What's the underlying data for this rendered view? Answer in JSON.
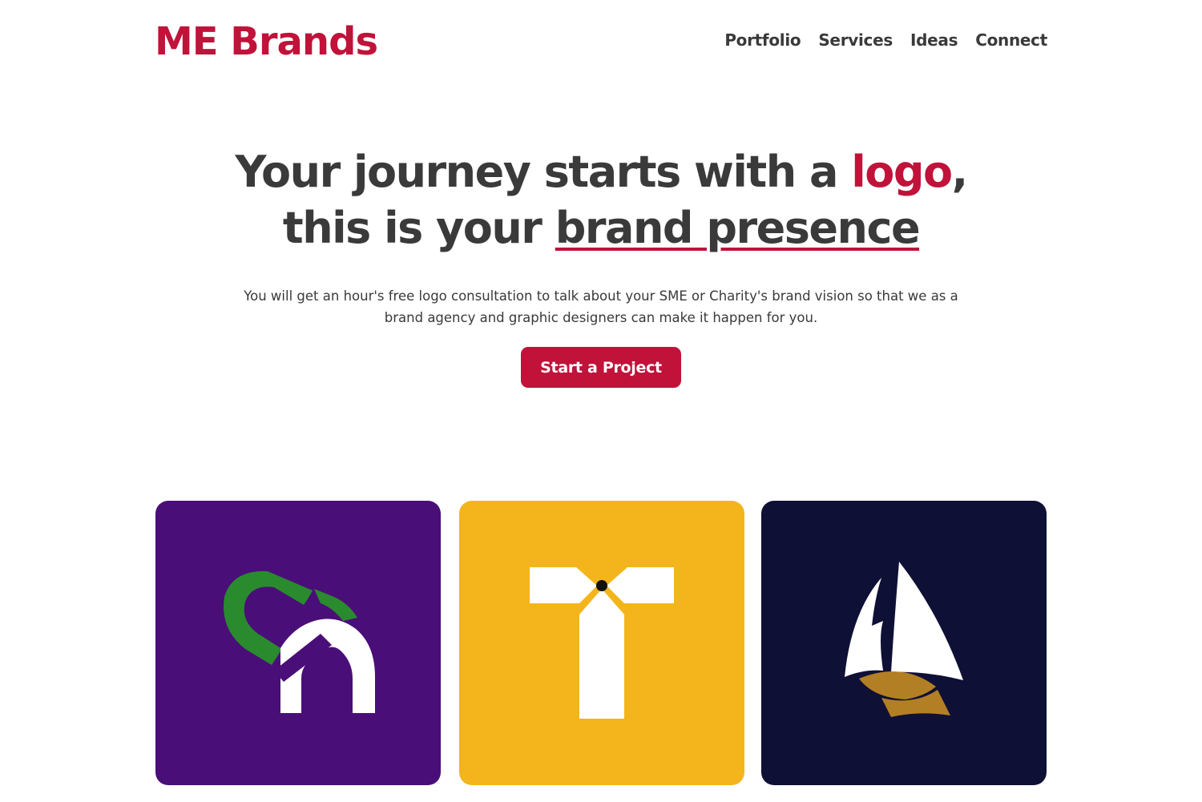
{
  "header": {
    "brand": "ME Brands",
    "nav": [
      {
        "label": "Portfolio"
      },
      {
        "label": "Services"
      },
      {
        "label": "Ideas"
      },
      {
        "label": "Connect"
      }
    ]
  },
  "hero": {
    "line1_prefix": "Your journey starts with a ",
    "line1_accent": "logo",
    "line1_suffix": ",",
    "line2_prefix": "this is your ",
    "line2_underlined": "brand presence",
    "subtitle": "You will get an hour's free logo consultation to talk about your SME or Charity's brand vision so that we as a brand agency and graphic designers can make it happen for you.",
    "cta_label": "Start a Project"
  },
  "portfolio": [
    {
      "name": "ca-logo",
      "background": "#4a0e78"
    },
    {
      "name": "t-logo",
      "background": "#f3b51b"
    },
    {
      "name": "sailboat-logo",
      "background": "#0f1035"
    }
  ],
  "colors": {
    "accent": "#c1123a",
    "text": "#3a3a3a"
  }
}
